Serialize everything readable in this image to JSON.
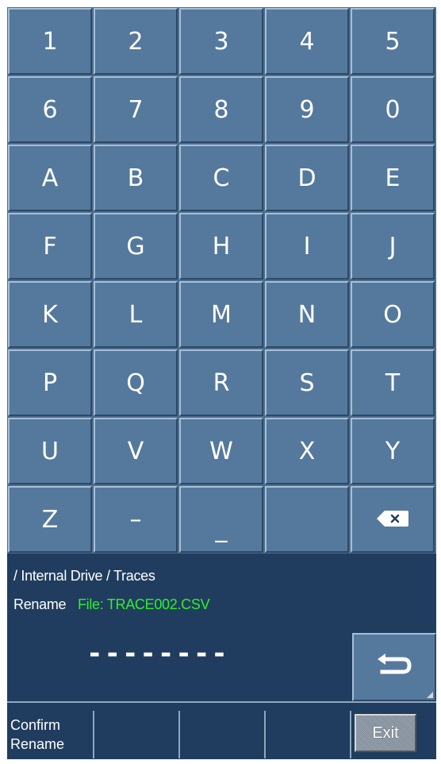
{
  "keypad": {
    "rows": [
      [
        "1",
        "2",
        "3",
        "4",
        "5"
      ],
      [
        "6",
        "7",
        "8",
        "9",
        "0"
      ],
      [
        "A",
        "B",
        "C",
        "D",
        "E"
      ],
      [
        "F",
        "G",
        "H",
        "I",
        "J"
      ],
      [
        "K",
        "L",
        "M",
        "N",
        "O"
      ],
      [
        "P",
        "Q",
        "R",
        "S",
        "T"
      ],
      [
        "U",
        "V",
        "W",
        "X",
        "Y"
      ],
      [
        "Z",
        "–",
        "_",
        "",
        "backspace-icon"
      ]
    ]
  },
  "info": {
    "path": "/ Internal Drive / Traces",
    "rename_label": "Rename",
    "file_label": "File: TRACE002.CSV",
    "input_value": "--------"
  },
  "enter_button": {
    "icon": "enter-arrow-icon"
  },
  "softkeys": {
    "confirm_line1": "Confirm",
    "confirm_line2": "Rename",
    "exit_label": "Exit"
  },
  "colors": {
    "key_face": "#55799c",
    "panel_bg": "#203d5f",
    "file_text": "#2ef02a"
  }
}
